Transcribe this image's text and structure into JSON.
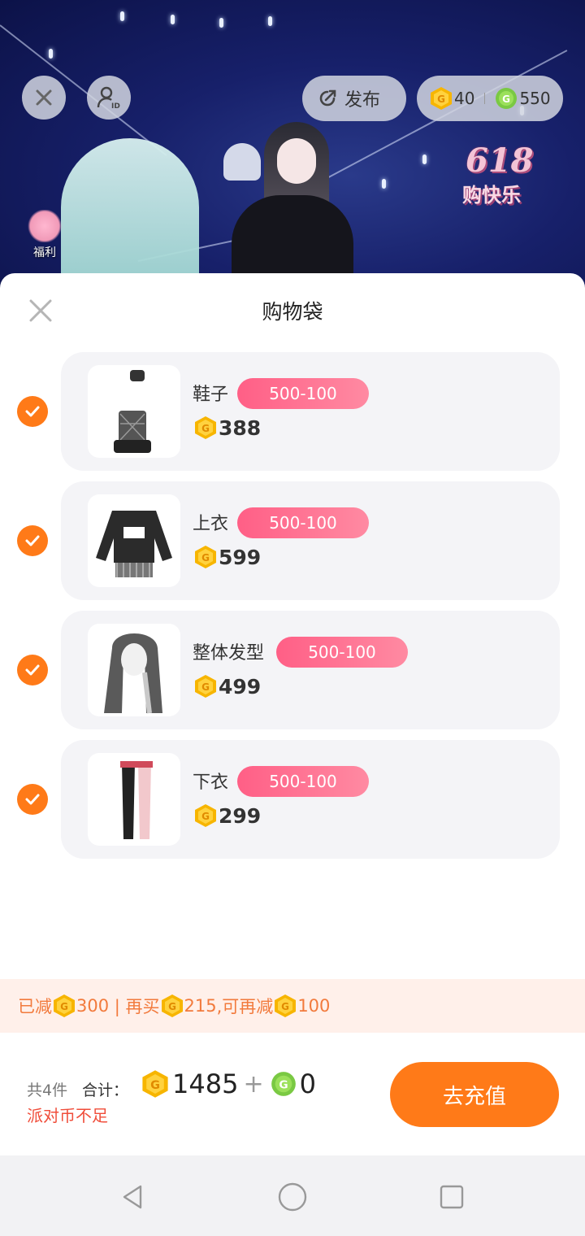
{
  "scene": {
    "publish_label": "发布",
    "currency": {
      "gold": "40",
      "green": "550"
    },
    "fuli_label": "福利",
    "promo_number": "618",
    "promo_text": "购快乐"
  },
  "sheet": {
    "title": "购物袋",
    "items": [
      {
        "name": "鞋子",
        "tag": "500-100",
        "price": "388",
        "checked": true
      },
      {
        "name": "上衣",
        "tag": "500-100",
        "price": "599",
        "checked": true
      },
      {
        "name": "整体发型",
        "tag": "500-100",
        "price": "499",
        "checked": true
      },
      {
        "name": "下衣",
        "tag": "500-100",
        "price": "299",
        "checked": true
      }
    ],
    "discount": {
      "reduced_prefix": "已减",
      "reduced_amount": "300",
      "buy_more_prefix": " | 再买",
      "buy_more_amount": "215",
      "can_reduce_prefix": ",可再减",
      "can_reduce_amount": "100"
    },
    "footer": {
      "count": "共4件",
      "total_label": "合计：",
      "gold_total": "1485",
      "plus": "+",
      "green_total": "0",
      "warning": "派对币不足",
      "recharge_label": "去充值"
    }
  },
  "colors": {
    "accent": "#ff7a18",
    "tag": "#ff6b8e",
    "gold_coin": "#f7b500",
    "green_coin": "#7ac943"
  },
  "icons": [
    "close-icon",
    "profile-id-icon",
    "publish-icon",
    "gold-coin-icon",
    "green-coin-icon",
    "checkmark-icon",
    "back-nav-icon",
    "home-nav-icon",
    "recents-nav-icon"
  ]
}
